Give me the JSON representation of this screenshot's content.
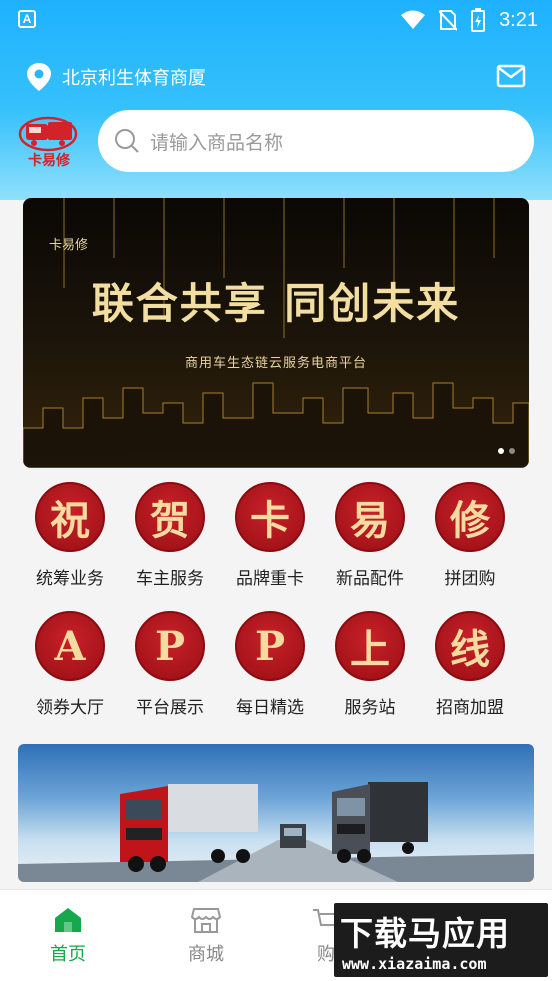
{
  "status_bar": {
    "time": "3:21"
  },
  "location": {
    "text": "北京利生体育商厦"
  },
  "logo": {
    "text": "卡易修"
  },
  "search": {
    "placeholder": "请输入商品名称"
  },
  "banner": {
    "brand": "卡易修",
    "title": "联合共享 同创未来",
    "subtitle": "商用车生态链云服务电商平台",
    "active_dot": 0,
    "dot_count": 2
  },
  "grid": {
    "items": [
      {
        "glyph": "祝",
        "label": "统筹业务"
      },
      {
        "glyph": "贺",
        "label": "车主服务"
      },
      {
        "glyph": "卡",
        "label": "品牌重卡"
      },
      {
        "glyph": "易",
        "label": "新品配件"
      },
      {
        "glyph": "修",
        "label": "拼团购"
      },
      {
        "glyph": "A",
        "label": "领券大厅"
      },
      {
        "glyph": "P",
        "label": "平台展示"
      },
      {
        "glyph": "P",
        "label": "每日精选"
      },
      {
        "glyph": "上",
        "label": "服务站"
      },
      {
        "glyph": "线",
        "label": "招商加盟"
      }
    ]
  },
  "tabbar": {
    "tabs": [
      {
        "label": "首页",
        "icon": "home-icon",
        "active": true
      },
      {
        "label": "商城",
        "icon": "store-icon",
        "active": false
      },
      {
        "label": "购",
        "icon": "cart-icon",
        "active": false
      }
    ]
  },
  "watermark": {
    "main": "下载马应用",
    "sub": "www.xiazaima.com"
  },
  "colors": {
    "header": "#1fb1ff",
    "accent_red": "#a8141b",
    "active_green": "#17a74c"
  }
}
